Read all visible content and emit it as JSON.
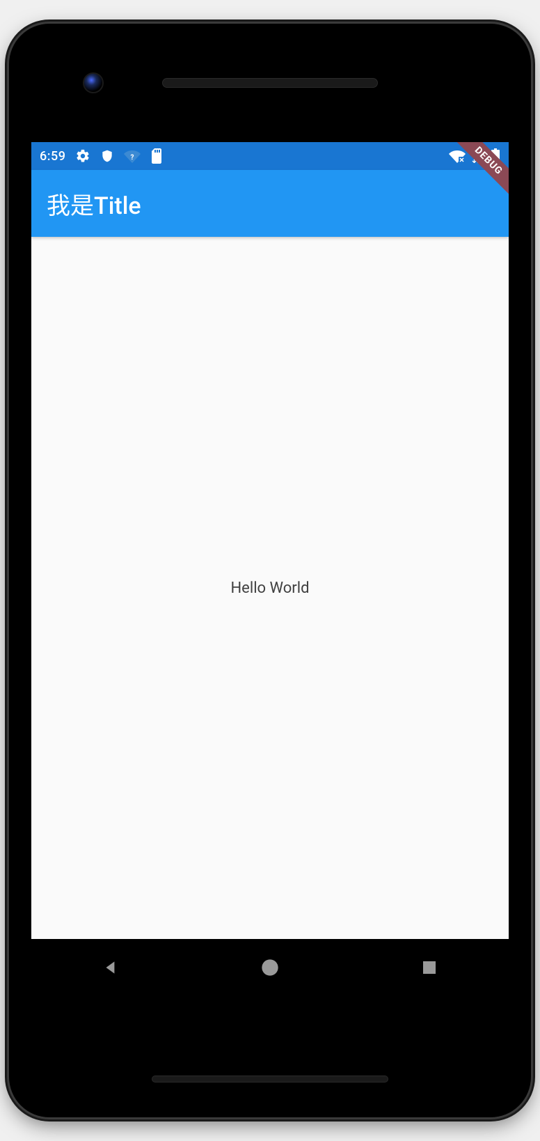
{
  "statusBar": {
    "time": "6:59",
    "icons": {
      "settings": "settings-icon",
      "shield": "shield-icon",
      "wifiHelp": "wifi-help-icon",
      "sdCard": "sd-card-icon",
      "wifiOff": "wifi-x-icon",
      "signal": "signal-icon",
      "battery": "battery-icon"
    }
  },
  "appBar": {
    "title": "我是Title"
  },
  "debugBanner": {
    "label": "DEBUG"
  },
  "body": {
    "text": "Hello World"
  },
  "colors": {
    "statusBar": "#1976D2",
    "appBar": "#2196F3",
    "background": "#fafafa",
    "debugBanner": "#8B4955"
  }
}
